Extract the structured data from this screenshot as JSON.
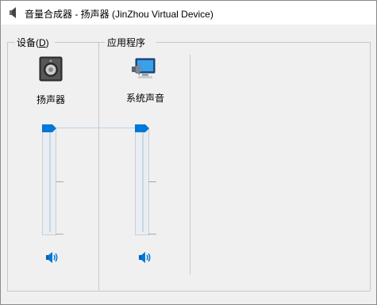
{
  "window": {
    "title": "音量合成器 - 扬声器 (JinZhou Virtual Device)"
  },
  "device_section": {
    "title_prefix": "设备(",
    "title_accel": "D",
    "title_suffix": ")",
    "device": {
      "label": "扬声器",
      "icon": "speaker-device-icon",
      "volume_fraction": 1.0,
      "mute_icon": "speaker-volume-icon"
    }
  },
  "apps_section": {
    "title": "应用程序",
    "apps": [
      {
        "label": "系统声音",
        "icon": "system-sounds-icon",
        "volume_fraction": 1.0,
        "mute_icon": "speaker-volume-icon"
      }
    ]
  },
  "colors": {
    "accent": "#0078d7",
    "link_line": "#b7d3ee"
  }
}
